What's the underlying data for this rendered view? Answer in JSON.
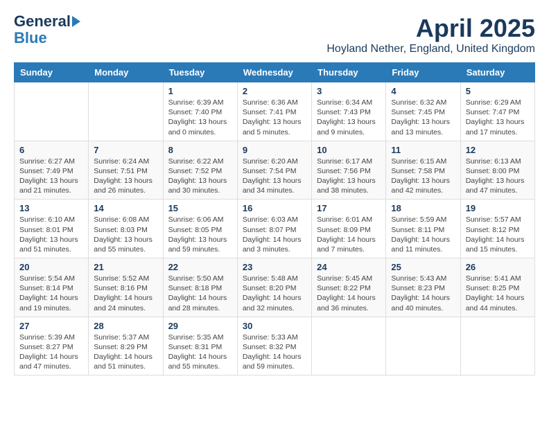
{
  "header": {
    "logo_general": "General",
    "logo_blue": "Blue",
    "title": "April 2025",
    "subtitle": "Hoyland Nether, England, United Kingdom"
  },
  "days_of_week": [
    "Sunday",
    "Monday",
    "Tuesday",
    "Wednesday",
    "Thursday",
    "Friday",
    "Saturday"
  ],
  "weeks": [
    [
      {
        "day": "",
        "content": ""
      },
      {
        "day": "",
        "content": ""
      },
      {
        "day": "1",
        "content": "Sunrise: 6:39 AM\nSunset: 7:40 PM\nDaylight: 13 hours and 0 minutes."
      },
      {
        "day": "2",
        "content": "Sunrise: 6:36 AM\nSunset: 7:41 PM\nDaylight: 13 hours and 5 minutes."
      },
      {
        "day": "3",
        "content": "Sunrise: 6:34 AM\nSunset: 7:43 PM\nDaylight: 13 hours and 9 minutes."
      },
      {
        "day": "4",
        "content": "Sunrise: 6:32 AM\nSunset: 7:45 PM\nDaylight: 13 hours and 13 minutes."
      },
      {
        "day": "5",
        "content": "Sunrise: 6:29 AM\nSunset: 7:47 PM\nDaylight: 13 hours and 17 minutes."
      }
    ],
    [
      {
        "day": "6",
        "content": "Sunrise: 6:27 AM\nSunset: 7:49 PM\nDaylight: 13 hours and 21 minutes."
      },
      {
        "day": "7",
        "content": "Sunrise: 6:24 AM\nSunset: 7:51 PM\nDaylight: 13 hours and 26 minutes."
      },
      {
        "day": "8",
        "content": "Sunrise: 6:22 AM\nSunset: 7:52 PM\nDaylight: 13 hours and 30 minutes."
      },
      {
        "day": "9",
        "content": "Sunrise: 6:20 AM\nSunset: 7:54 PM\nDaylight: 13 hours and 34 minutes."
      },
      {
        "day": "10",
        "content": "Sunrise: 6:17 AM\nSunset: 7:56 PM\nDaylight: 13 hours and 38 minutes."
      },
      {
        "day": "11",
        "content": "Sunrise: 6:15 AM\nSunset: 7:58 PM\nDaylight: 13 hours and 42 minutes."
      },
      {
        "day": "12",
        "content": "Sunrise: 6:13 AM\nSunset: 8:00 PM\nDaylight: 13 hours and 47 minutes."
      }
    ],
    [
      {
        "day": "13",
        "content": "Sunrise: 6:10 AM\nSunset: 8:01 PM\nDaylight: 13 hours and 51 minutes."
      },
      {
        "day": "14",
        "content": "Sunrise: 6:08 AM\nSunset: 8:03 PM\nDaylight: 13 hours and 55 minutes."
      },
      {
        "day": "15",
        "content": "Sunrise: 6:06 AM\nSunset: 8:05 PM\nDaylight: 13 hours and 59 minutes."
      },
      {
        "day": "16",
        "content": "Sunrise: 6:03 AM\nSunset: 8:07 PM\nDaylight: 14 hours and 3 minutes."
      },
      {
        "day": "17",
        "content": "Sunrise: 6:01 AM\nSunset: 8:09 PM\nDaylight: 14 hours and 7 minutes."
      },
      {
        "day": "18",
        "content": "Sunrise: 5:59 AM\nSunset: 8:11 PM\nDaylight: 14 hours and 11 minutes."
      },
      {
        "day": "19",
        "content": "Sunrise: 5:57 AM\nSunset: 8:12 PM\nDaylight: 14 hours and 15 minutes."
      }
    ],
    [
      {
        "day": "20",
        "content": "Sunrise: 5:54 AM\nSunset: 8:14 PM\nDaylight: 14 hours and 19 minutes."
      },
      {
        "day": "21",
        "content": "Sunrise: 5:52 AM\nSunset: 8:16 PM\nDaylight: 14 hours and 24 minutes."
      },
      {
        "day": "22",
        "content": "Sunrise: 5:50 AM\nSunset: 8:18 PM\nDaylight: 14 hours and 28 minutes."
      },
      {
        "day": "23",
        "content": "Sunrise: 5:48 AM\nSunset: 8:20 PM\nDaylight: 14 hours and 32 minutes."
      },
      {
        "day": "24",
        "content": "Sunrise: 5:45 AM\nSunset: 8:22 PM\nDaylight: 14 hours and 36 minutes."
      },
      {
        "day": "25",
        "content": "Sunrise: 5:43 AM\nSunset: 8:23 PM\nDaylight: 14 hours and 40 minutes."
      },
      {
        "day": "26",
        "content": "Sunrise: 5:41 AM\nSunset: 8:25 PM\nDaylight: 14 hours and 44 minutes."
      }
    ],
    [
      {
        "day": "27",
        "content": "Sunrise: 5:39 AM\nSunset: 8:27 PM\nDaylight: 14 hours and 47 minutes."
      },
      {
        "day": "28",
        "content": "Sunrise: 5:37 AM\nSunset: 8:29 PM\nDaylight: 14 hours and 51 minutes."
      },
      {
        "day": "29",
        "content": "Sunrise: 5:35 AM\nSunset: 8:31 PM\nDaylight: 14 hours and 55 minutes."
      },
      {
        "day": "30",
        "content": "Sunrise: 5:33 AM\nSunset: 8:32 PM\nDaylight: 14 hours and 59 minutes."
      },
      {
        "day": "",
        "content": ""
      },
      {
        "day": "",
        "content": ""
      },
      {
        "day": "",
        "content": ""
      }
    ]
  ]
}
